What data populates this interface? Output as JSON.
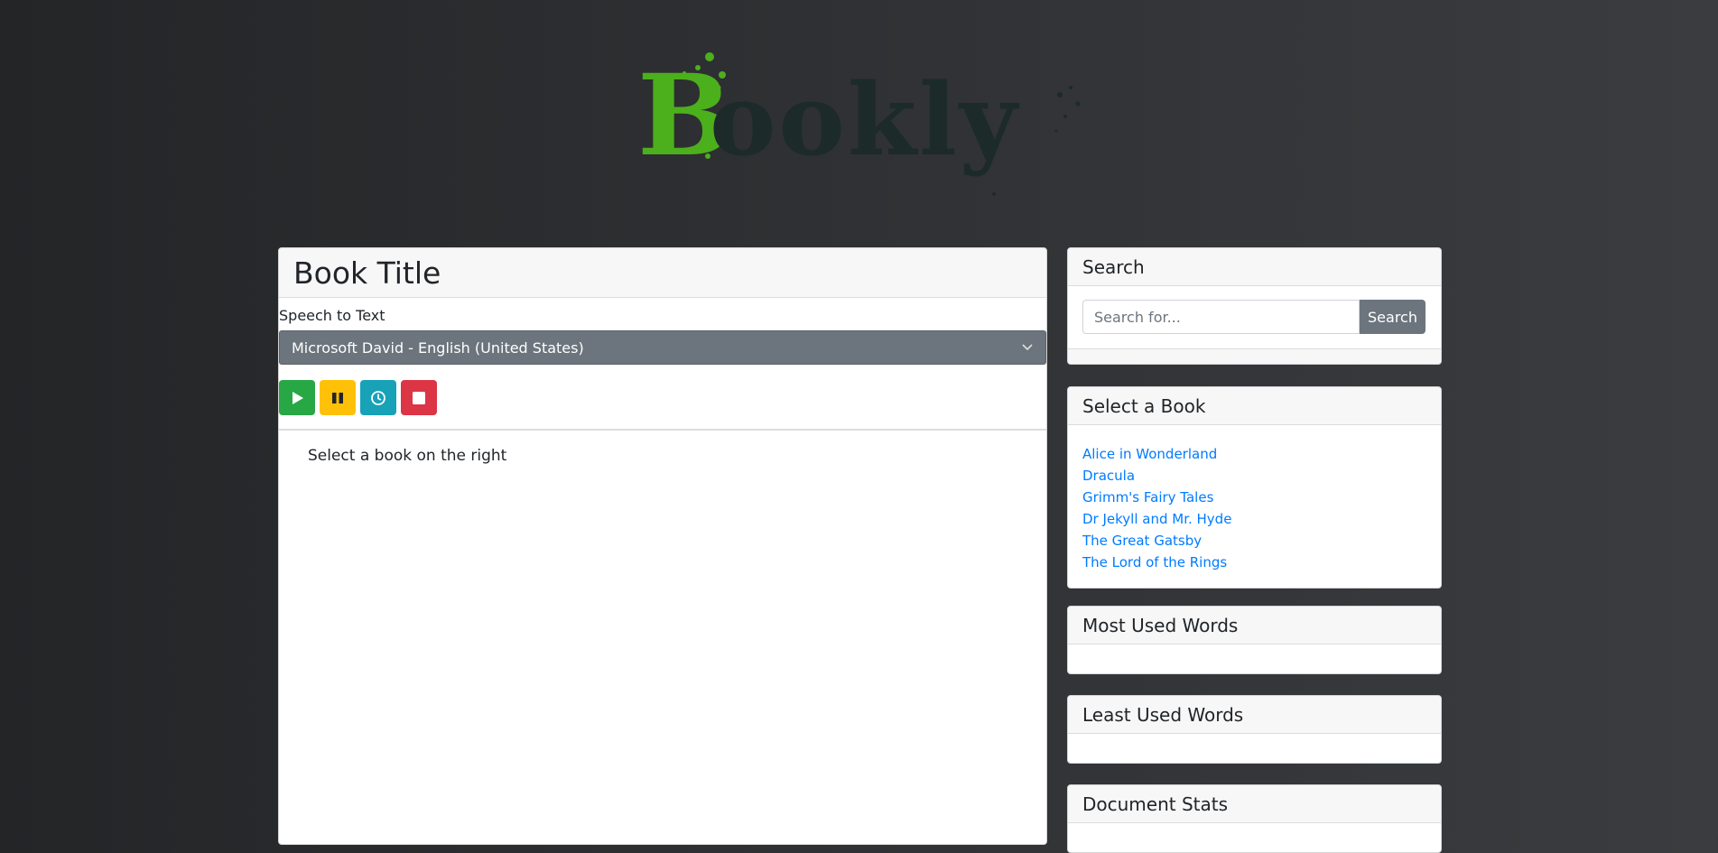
{
  "brand": {
    "logo_text": "Bookly",
    "initial": "B",
    "rest": "ookly",
    "initial_color": "#4caf1c",
    "rest_color": "#1c2a2a"
  },
  "main": {
    "title": "Book Title",
    "speech_label": "Speech to Text",
    "voice_selected": "Microsoft David - English (United States)",
    "controls": {
      "play_icon": "play-icon",
      "pause_icon": "pause-icon",
      "timer_icon": "clock-icon",
      "stop_icon": "stop-icon"
    },
    "placeholder_text": "Select a book on the right"
  },
  "sidebar": {
    "search": {
      "title": "Search",
      "placeholder": "Search for...",
      "button_label": "Search"
    },
    "books": {
      "title": "Select a Book",
      "items": [
        "Alice in Wonderland",
        "Dracula",
        "Grimm's Fairy Tales",
        "Dr Jekyll and Mr. Hyde",
        "The Great Gatsby",
        "The Lord of the Rings"
      ]
    },
    "most_used": {
      "title": "Most Used Words"
    },
    "least_used": {
      "title": "Least Used Words"
    },
    "stats": {
      "title": "Document Stats"
    }
  },
  "colors": {
    "play": "#28a745",
    "pause": "#ffc107",
    "timer": "#17a2b8",
    "stop": "#dc3545",
    "link": "#007bff",
    "select_bg": "#6c757d"
  }
}
